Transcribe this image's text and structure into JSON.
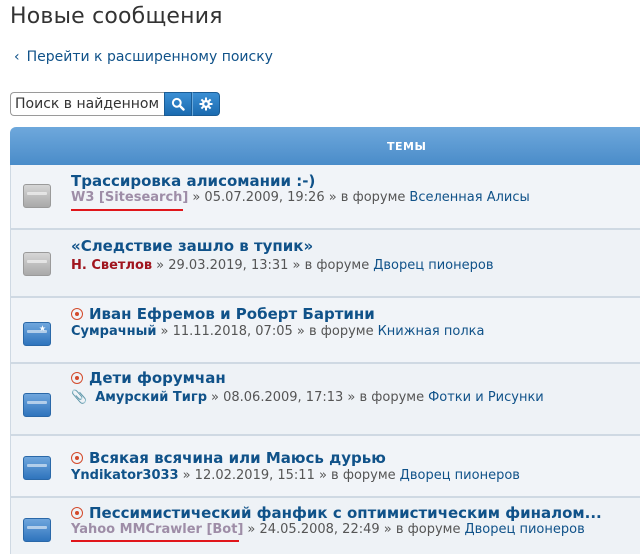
{
  "page": {
    "title": "Новые сообщения"
  },
  "advanced_search": {
    "label": "Перейти к расширенному поиску"
  },
  "search": {
    "placeholder": "Поиск в найденном"
  },
  "table": {
    "header": "ТЕМЫ"
  },
  "topics": [
    {
      "title": "Трассировка алисомании :-)",
      "author": "W3 [Sitesearch]",
      "date": "» 05.07.2009, 19:26 » в форуме",
      "forum": "Вселенная Алисы"
    },
    {
      "title": "«Следствие зашло в тупик»",
      "author": "Н. Светлов",
      "date": "» 29.03.2019, 13:31 » в форуме",
      "forum": "Дворец пионеров"
    },
    {
      "title": "Иван Ефремов и Роберт Бартини",
      "author": "Сумрачный",
      "date": "» 11.11.2018, 07:05 » в форуме",
      "forum": "Книжная полка"
    },
    {
      "title": "Дети форумчан",
      "author": "Амурский Тигр",
      "date": "» 08.06.2009, 17:13 » в форуме",
      "forum": "Фотки и Рисунки"
    },
    {
      "title": "Всякая всячина или Маюсь дурью",
      "author": "Yndikator3033",
      "date": "» 12.02.2019, 15:11 » в форуме",
      "forum": "Дворец пионеров"
    },
    {
      "title": "Пессимистический фанфик с оптимистическим финалом...",
      "author": "Yahoo MMCrawler [Bot]",
      "date": "» 24.05.2008, 22:49 » в форуме",
      "forum": "Дворец пионеров"
    }
  ],
  "colors": {
    "accent": "#105289",
    "header": "#5b99d2",
    "unread_marker": "#d34a2b",
    "annotation_underline": "#e0161b"
  }
}
